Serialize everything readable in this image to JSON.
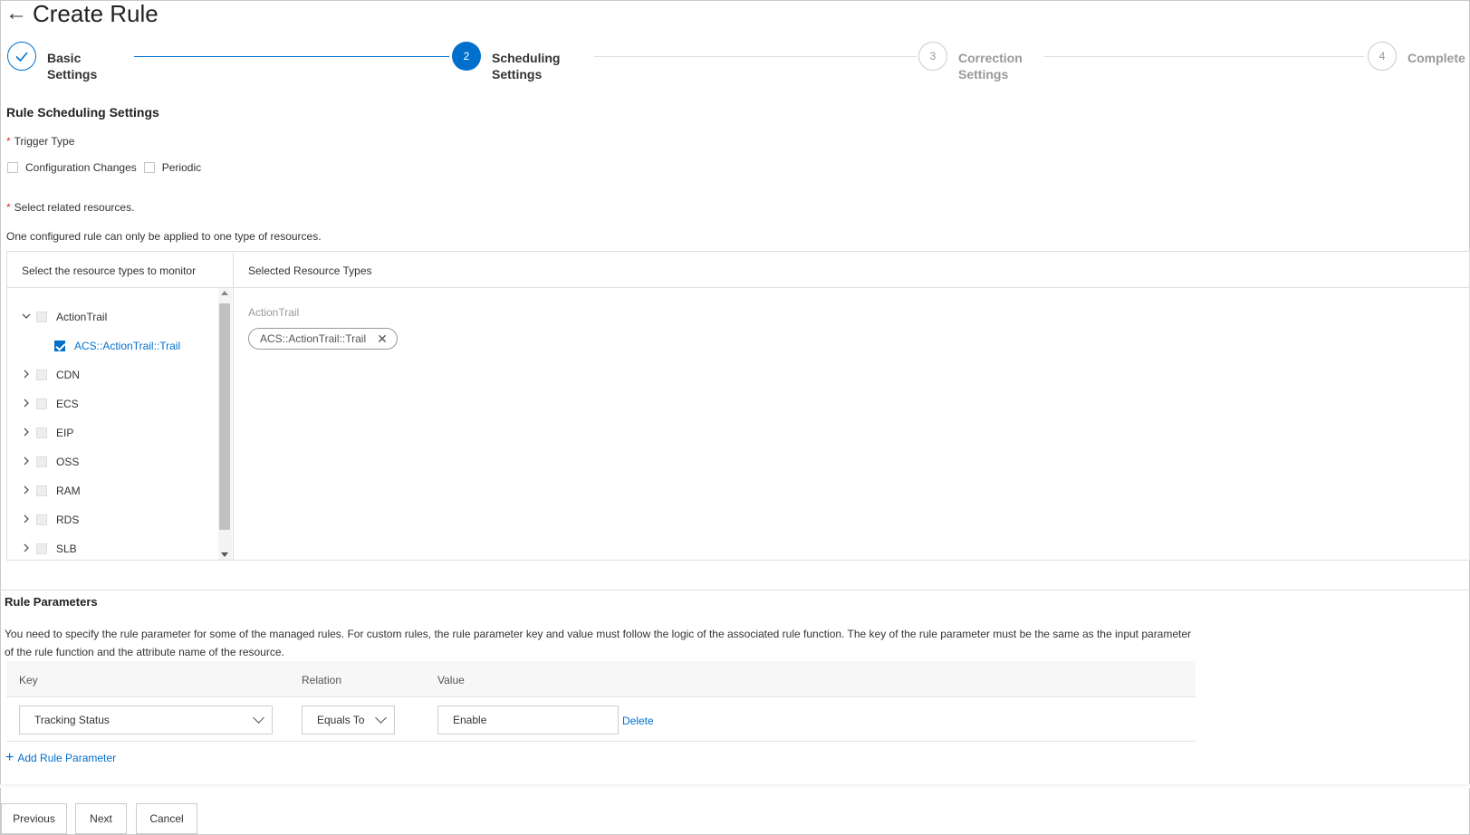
{
  "header": {
    "back_icon": "arrow-left-icon",
    "title": "Create Rule"
  },
  "steps": [
    {
      "number": "",
      "label_line1": "Basic",
      "label_line2": "Settings",
      "state": "done"
    },
    {
      "number": "2",
      "label_line1": "Scheduling",
      "label_line2": "Settings",
      "state": "active"
    },
    {
      "number": "3",
      "label_line1": "Correction",
      "label_line2": "Settings",
      "state": "todo"
    },
    {
      "number": "4",
      "label_line1": "Complete",
      "label_line2": "",
      "state": "todo"
    }
  ],
  "scheduling": {
    "title": "Rule Scheduling Settings",
    "trigger_label": "Trigger Type",
    "trigger_options": [
      {
        "label": "Configuration Changes",
        "checked": false
      },
      {
        "label": "Periodic",
        "checked": false
      }
    ],
    "related_label": "Select related resources.",
    "note": "One configured rule can only be applied to one type of resources.",
    "col_left": "Select the resource types to monitor",
    "col_right": "Selected Resource Types",
    "tree": [
      {
        "label": "ActionTrail",
        "expanded": true
      },
      {
        "label": "ACS::ActionTrail::Trail",
        "child": true,
        "checked": true
      },
      {
        "label": "CDN"
      },
      {
        "label": "ECS"
      },
      {
        "label": "EIP"
      },
      {
        "label": "OSS"
      },
      {
        "label": "RAM"
      },
      {
        "label": "RDS"
      },
      {
        "label": "SLB"
      }
    ],
    "selected_group": "ActionTrail",
    "selected_tag": "ACS::ActionTrail::Trail"
  },
  "params": {
    "title": "Rule Parameters",
    "description_line1": "You need to specify the rule parameter for some of the managed rules. For custom rules, the rule parameter key and value must follow the logic of the associated rule function. The key of the rule parameter must be the same as the input parameter",
    "description_line2": "of the rule function and the attribute name of the resource.",
    "col_key": "Key",
    "col_relation": "Relation",
    "col_value": "Value",
    "row": {
      "key": "Tracking Status",
      "relation": "Equals To",
      "value": "Enable",
      "delete": "Delete"
    },
    "add_label": "Add Rule Parameter"
  },
  "footer": {
    "previous": "Previous",
    "next": "Next",
    "cancel": "Cancel"
  },
  "colors": {
    "accent": "#0070cc",
    "required": "#d93026"
  }
}
